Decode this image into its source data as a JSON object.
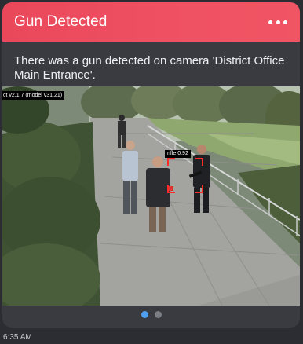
{
  "notification": {
    "title": "Gun Detected",
    "message": "There was a gun detected on camera 'District Office Main Entrance'.",
    "more_icon": "more-horizontal-icon",
    "header_color": "#ef4f61"
  },
  "camera": {
    "model_label": "ct v2.1.7 (model v31.21)",
    "detection": {
      "label": "rifle 0.92",
      "box_color": "#ff2a2a"
    }
  },
  "pager": {
    "pages": 2,
    "active_index": 0,
    "active_color": "#4f9ef0"
  },
  "timestamp": "6:35 AM"
}
